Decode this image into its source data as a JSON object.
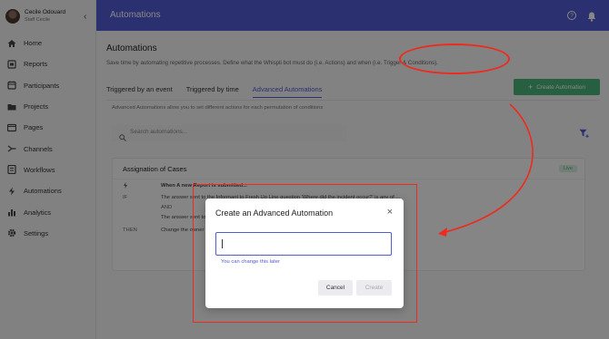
{
  "profile": {
    "name": "Cecile Odouard",
    "role": "Staff Cecile"
  },
  "sidebar": {
    "collapse_glyph": "‹",
    "items": [
      {
        "label": "Home",
        "icon": "home-icon"
      },
      {
        "label": "Reports",
        "icon": "reports-icon"
      },
      {
        "label": "Participants",
        "icon": "participants-icon"
      },
      {
        "label": "Projects",
        "icon": "folder-icon"
      },
      {
        "label": "Pages",
        "icon": "pages-icon"
      },
      {
        "label": "Channels",
        "icon": "channels-icon"
      },
      {
        "label": "Workflows",
        "icon": "workflows-icon"
      },
      {
        "label": "Automations",
        "icon": "lightning-icon"
      },
      {
        "label": "Analytics",
        "icon": "analytics-icon"
      },
      {
        "label": "Settings",
        "icon": "gear-icon"
      }
    ]
  },
  "topbar": {
    "title": "Automations",
    "help_glyph": "?"
  },
  "page": {
    "title": "Automations",
    "description": "Save time by automating repetitive processes. Define what the Whispli bot must do (i.e. Actions) and when (i.e. Trigger & Conditions).",
    "create_button": "Create Automation",
    "create_plus": "+",
    "tabs": [
      "Triggered by an event",
      "Triggered by time",
      "Advanced Automations"
    ],
    "active_tab": "Advanced Automations",
    "tab_description": "Advanced Automations allow you to set different actions for each permutation of conditions",
    "search_placeholder": "Search automations..."
  },
  "card": {
    "title": "Assignation of Cases",
    "status": "Live",
    "when_text": "When A new Report is submitted...",
    "if_label": "IF",
    "if_text_1": "The answer sent to the Informant to Fresh Up Line question 'Where did the incident occur?' is any of ...",
    "and_label": "AND",
    "if_text_2": "The answer sent to the informant of disclosure? is any of ...",
    "then_label": "THEN",
    "then_text": "Change the owner"
  },
  "modal": {
    "title": "Create an Advanced Automation",
    "close_glyph": "×",
    "input_value": "",
    "helper": "You can change this later",
    "cancel": "Cancel",
    "create": "Create"
  },
  "colors": {
    "primary": "#515bd4",
    "success": "#4ab37b",
    "annotation": "#ef2a1e"
  }
}
